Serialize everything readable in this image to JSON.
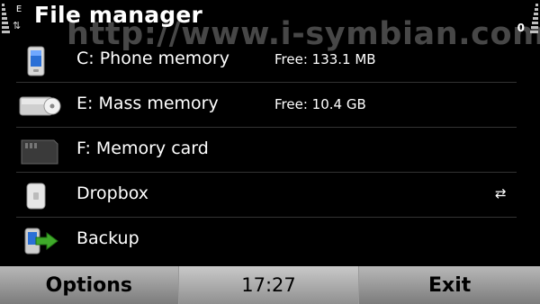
{
  "status": {
    "network_mode": "E",
    "battery_digit": "0"
  },
  "title": "File manager",
  "watermark": "http://www.i-symbian.com",
  "items": [
    {
      "label": "C: Phone memory",
      "info": "Free: 133.1 MB",
      "icon": "phone-memory-icon"
    },
    {
      "label": "E: Mass memory",
      "info": "Free: 10.4 GB",
      "icon": "mass-memory-icon"
    },
    {
      "label": "F: Memory card",
      "info": "",
      "icon": "memory-card-icon"
    },
    {
      "label": "Dropbox",
      "info": "",
      "icon": "dropbox-icon",
      "trailing": "⇄"
    },
    {
      "label": "Backup",
      "info": "",
      "icon": "backup-icon"
    }
  ],
  "softkeys": {
    "left": "Options",
    "clock": "17:27",
    "right": "Exit"
  }
}
